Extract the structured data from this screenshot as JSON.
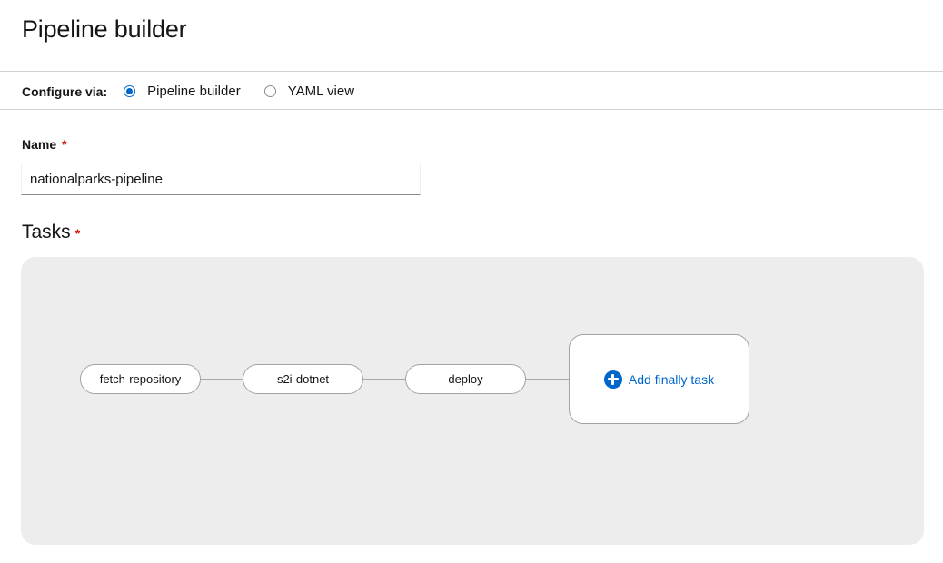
{
  "page": {
    "title": "Pipeline builder"
  },
  "configure": {
    "label": "Configure via:",
    "options": [
      {
        "label": "Pipeline builder",
        "selected": true
      },
      {
        "label": "YAML view",
        "selected": false
      }
    ]
  },
  "form": {
    "name_label": "Name",
    "required_marker": "*",
    "name_value": "nationalparks-pipeline"
  },
  "tasks": {
    "heading": "Tasks",
    "required_marker": "*",
    "nodes": [
      "fetch-repository",
      "s2i-dotnet",
      "deploy"
    ],
    "add_finally_label": "Add finally task"
  },
  "colors": {
    "accent": "#0066cc",
    "required": "#c9190b",
    "canvas_bg": "#ededed"
  },
  "icons": {
    "add_finally": "plus-circle-icon"
  }
}
